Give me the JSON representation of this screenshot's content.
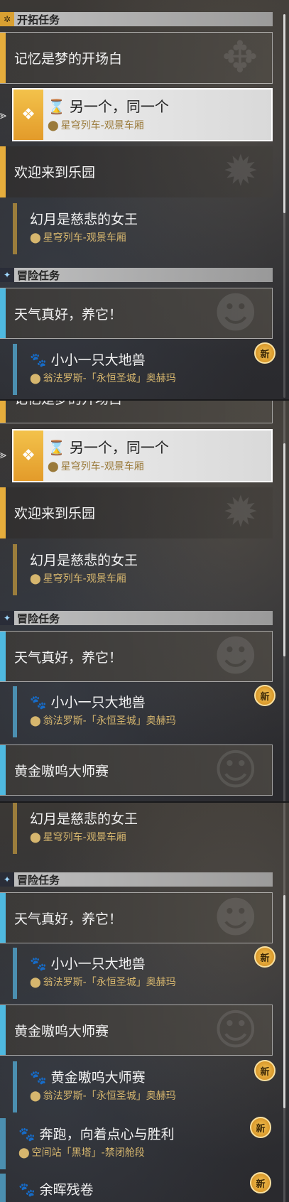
{
  "sections": {
    "trailblaze": "开拓任务",
    "adventure": "冒险任务"
  },
  "quests": {
    "memory": "记忆是梦的开场白",
    "another_same": "另一个，同一个",
    "welcome": "欢迎来到乐园",
    "moon_queen": "幻月是慈悲的女王",
    "weather": "天气真好，养它！",
    "little_beast": "小小一只大地兽",
    "golden_title": "黄金嗷呜大师赛",
    "run": "奔跑，向着点心与胜利",
    "remnant": "余晖残卷"
  },
  "locations": {
    "express": "星穹列车-观景车厢",
    "okhema": "翁法罗斯-「永恒圣城」奥赫玛",
    "herta": "空间站「黑塔」-禁闭舱段"
  },
  "badges": {
    "new": "新"
  },
  "icons": {
    "hourglass": "hourglass-icon",
    "pin": "location-pin-icon",
    "paw": "paw-icon",
    "arrow": "selection-arrow-icon"
  },
  "colors": {
    "gold": "#e6ad3c",
    "blue": "#4fb9e0"
  }
}
